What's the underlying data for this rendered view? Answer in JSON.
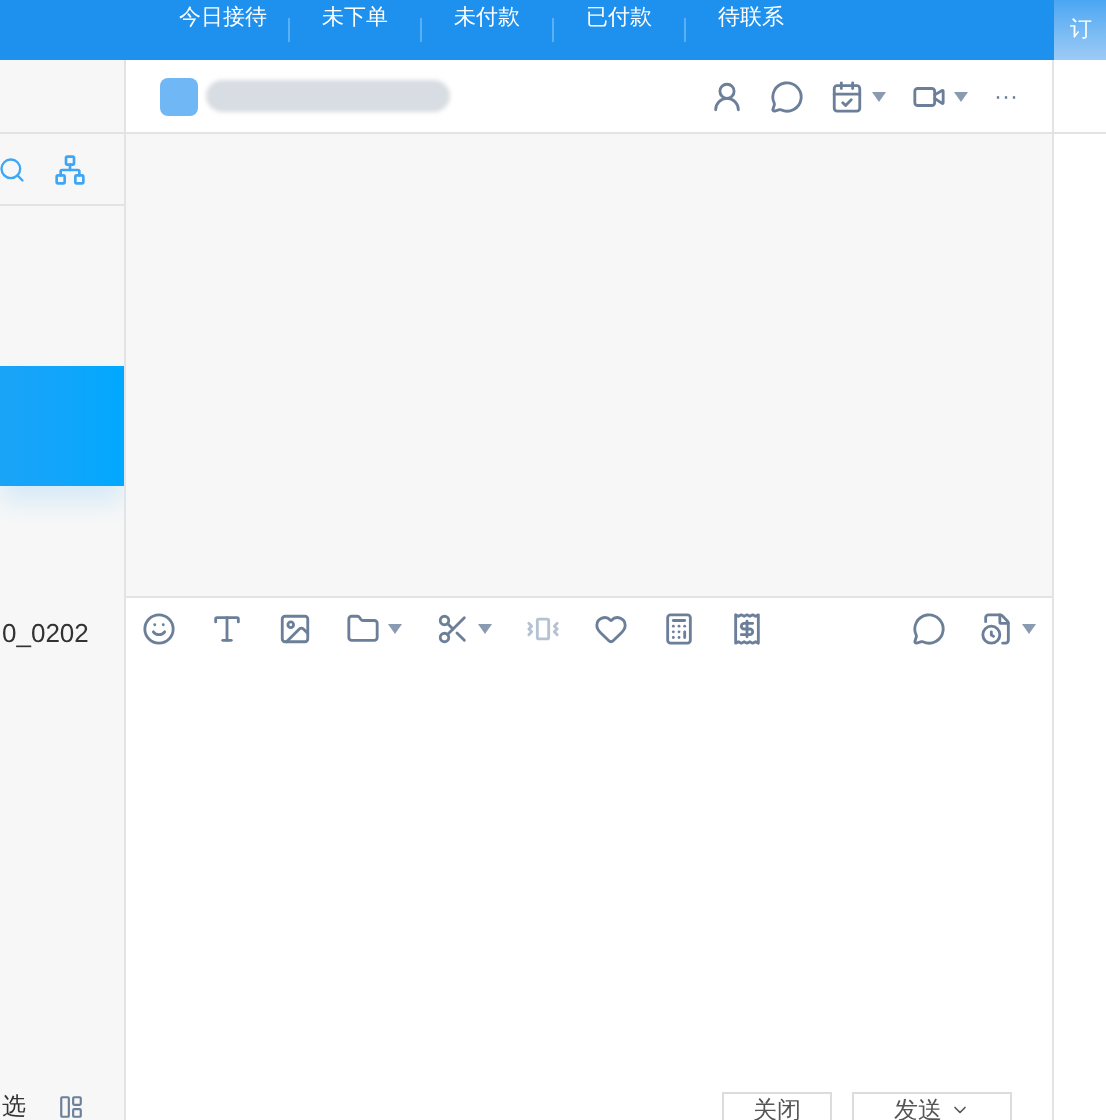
{
  "top_tabs": [
    {
      "label": "今日接待"
    },
    {
      "label": "未下单"
    },
    {
      "label": "未付款"
    },
    {
      "label": "已付款"
    },
    {
      "label": "待联系"
    }
  ],
  "top_right_tab": "订",
  "sidebar": {
    "selected_item": {
      "selected": true
    },
    "item_text": "0_0202",
    "bottom_text": "选"
  },
  "chat_header": {
    "more": "···"
  },
  "composer": {
    "buttons": [
      {
        "label": "关闭",
        "kind": "plain"
      },
      {
        "label": "发送",
        "kind": "split"
      }
    ]
  }
}
